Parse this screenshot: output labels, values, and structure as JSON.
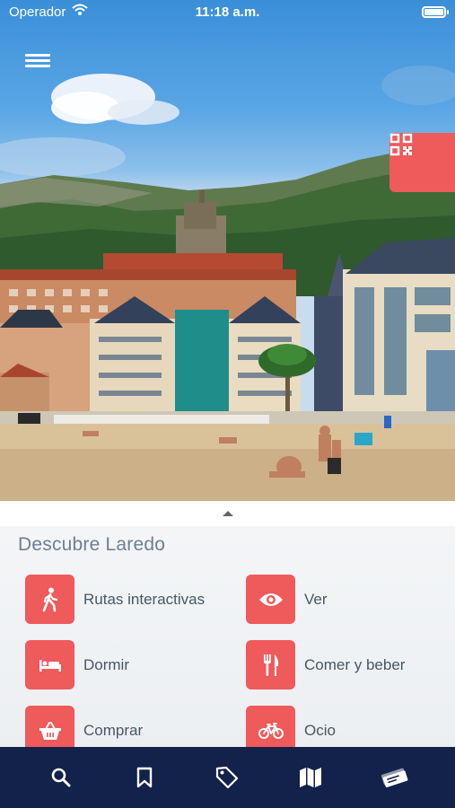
{
  "status_bar": {
    "carrier": "Operador",
    "time": "11:18 a.m."
  },
  "sheet": {
    "title": "Descubre Laredo",
    "categories": [
      {
        "label": "Rutas interactivas",
        "icon": "walking-person-icon"
      },
      {
        "label": "Ver",
        "icon": "eye-icon"
      },
      {
        "label": "Dormir",
        "icon": "bed-icon"
      },
      {
        "label": "Comer y beber",
        "icon": "fork-knife-icon"
      },
      {
        "label": "Comprar",
        "icon": "shopping-basket-icon"
      },
      {
        "label": "Ocio",
        "icon": "bicycle-icon"
      }
    ]
  },
  "tab_bar": {
    "tabs": [
      {
        "icon": "search-icon"
      },
      {
        "icon": "bookmark-icon"
      },
      {
        "icon": "tag-icon"
      },
      {
        "icon": "map-icon"
      },
      {
        "icon": "tickets-icon"
      }
    ]
  },
  "colors": {
    "accent": "#ef5a5a",
    "tab_bar_bg": "#13224a",
    "title_text": "#6b7f96",
    "label_text": "#4a5666"
  }
}
